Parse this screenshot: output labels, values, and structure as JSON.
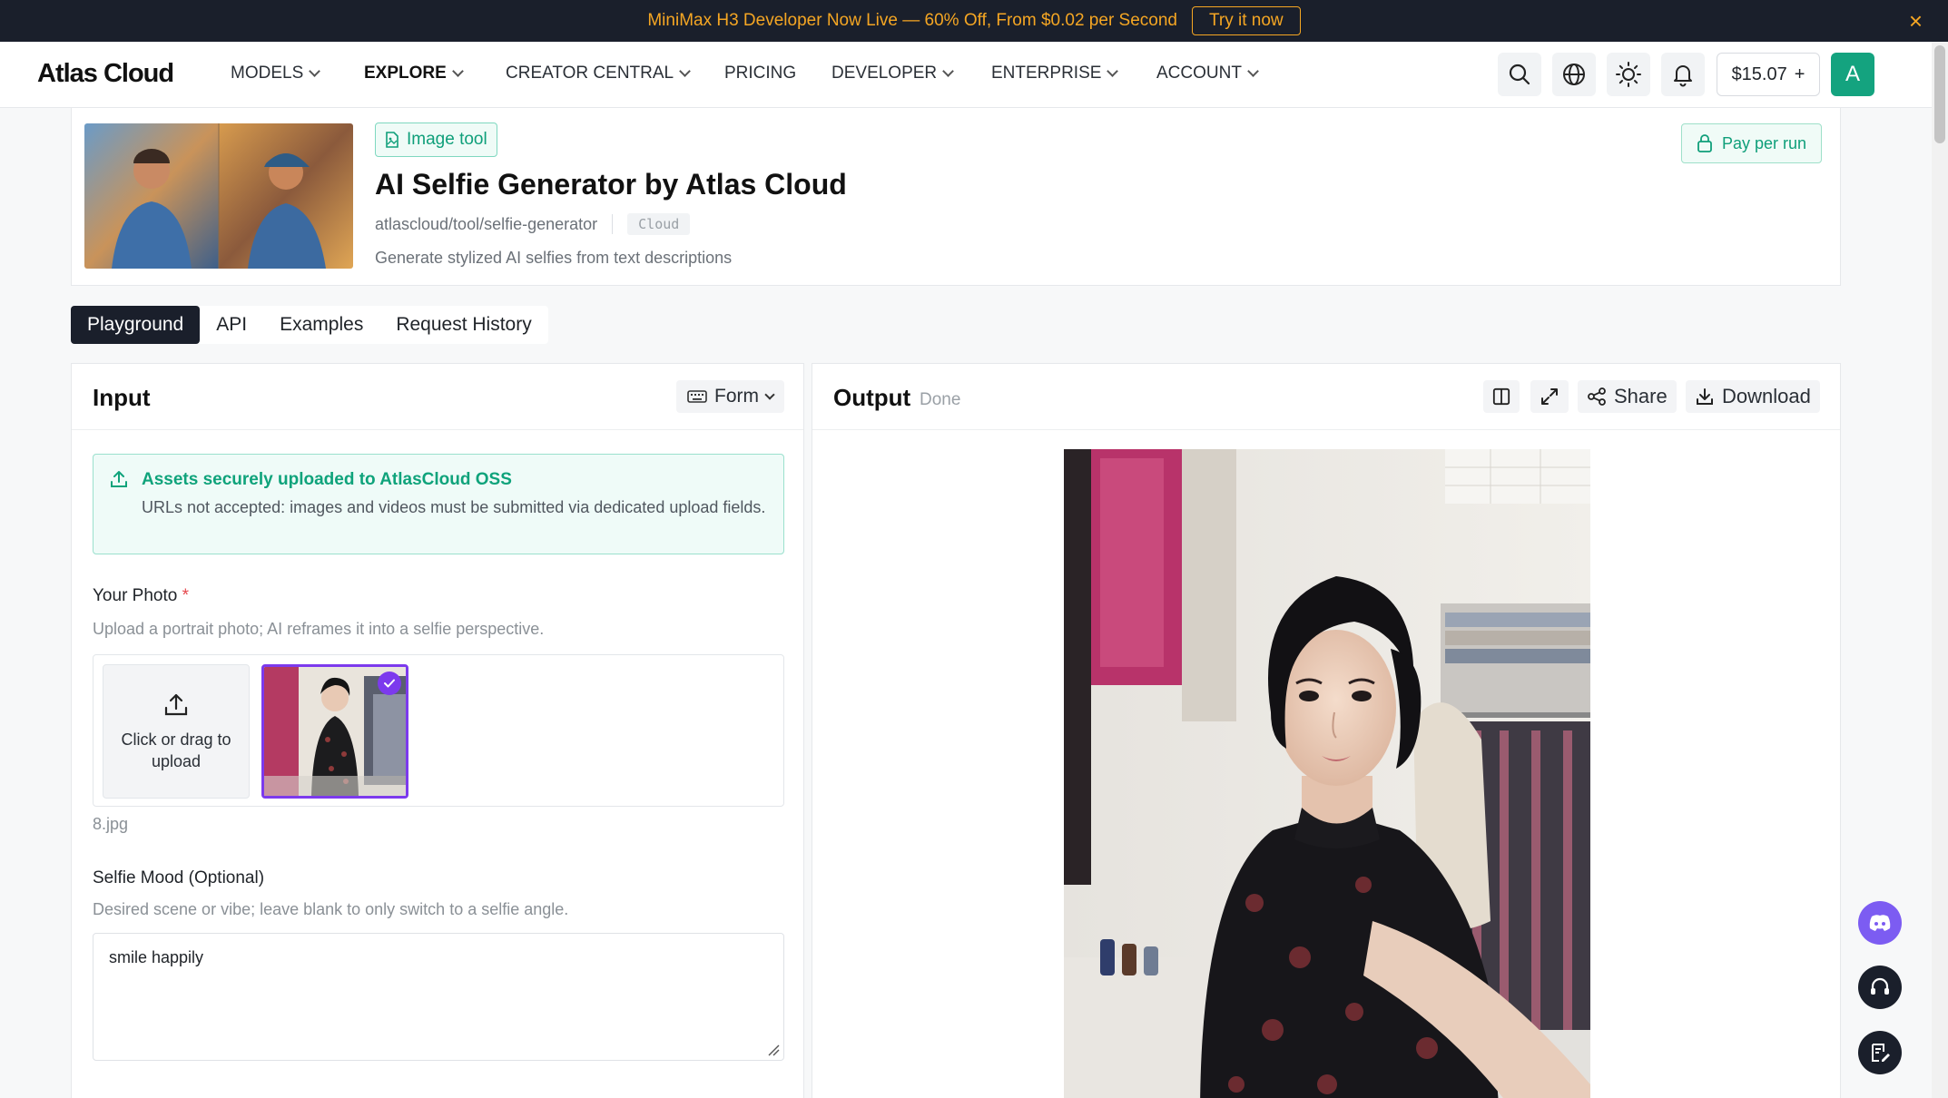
{
  "announcement": {
    "text": "MiniMax H3 Developer Now Live — 60% Off, From $0.02 per Second",
    "cta": "Try it now",
    "close_icon": "close-icon"
  },
  "nav": {
    "logo": "Atlas Cloud",
    "items": [
      {
        "label": "MODELS",
        "dropdown": true
      },
      {
        "label": "EXPLORE",
        "dropdown": true,
        "active": true
      },
      {
        "label": "CREATOR CENTRAL",
        "dropdown": true
      },
      {
        "label": "PRICING",
        "dropdown": false
      },
      {
        "label": "DEVELOPER",
        "dropdown": true
      },
      {
        "label": "ENTERPRISE",
        "dropdown": true
      },
      {
        "label": "ACCOUNT",
        "dropdown": true
      }
    ],
    "icons": [
      "search-icon",
      "globe-icon",
      "sun-icon",
      "bell-icon"
    ],
    "balance": "$15.07",
    "balance_plus": "+",
    "avatar_initial": "A",
    "accent": "#14a37f"
  },
  "model": {
    "badge": "Image tool",
    "title": "AI Selfie Generator by Atlas Cloud",
    "path": "atlascloud/tool/selfie-generator",
    "tag": "Cloud",
    "description": "Generate stylized AI selfies from text descriptions",
    "pay_label": "Pay per run"
  },
  "tabs": [
    {
      "label": "Playground",
      "active": true
    },
    {
      "label": "API"
    },
    {
      "label": "Examples"
    },
    {
      "label": "Request History"
    }
  ],
  "input": {
    "title": "Input",
    "mode": "Form",
    "notice": {
      "title": "Assets securely uploaded to AtlasCloud OSS",
      "body": "URLs not accepted: images and videos must be submitted via dedicated upload fields."
    },
    "photo": {
      "label": "Your Photo",
      "required_mark": "*",
      "help": "Upload a portrait photo; AI reframes it into a selfie perspective.",
      "upload_text": "Click or drag to upload",
      "file_name": "8.jpg"
    },
    "mood": {
      "label": "Selfie Mood (Optional)",
      "help": "Desired scene or vibe; leave blank to only switch to a selfie angle.",
      "value": "smile happily"
    }
  },
  "output": {
    "title": "Output",
    "status": "Done",
    "share_label": "Share",
    "download_label": "Download"
  },
  "colors": {
    "announce_bg": "#1a1f2b",
    "announce_text": "#f5a623",
    "brand_green": "#0fa37b",
    "selection_purple": "#7c3aed",
    "discord": "#7c5cf2"
  }
}
